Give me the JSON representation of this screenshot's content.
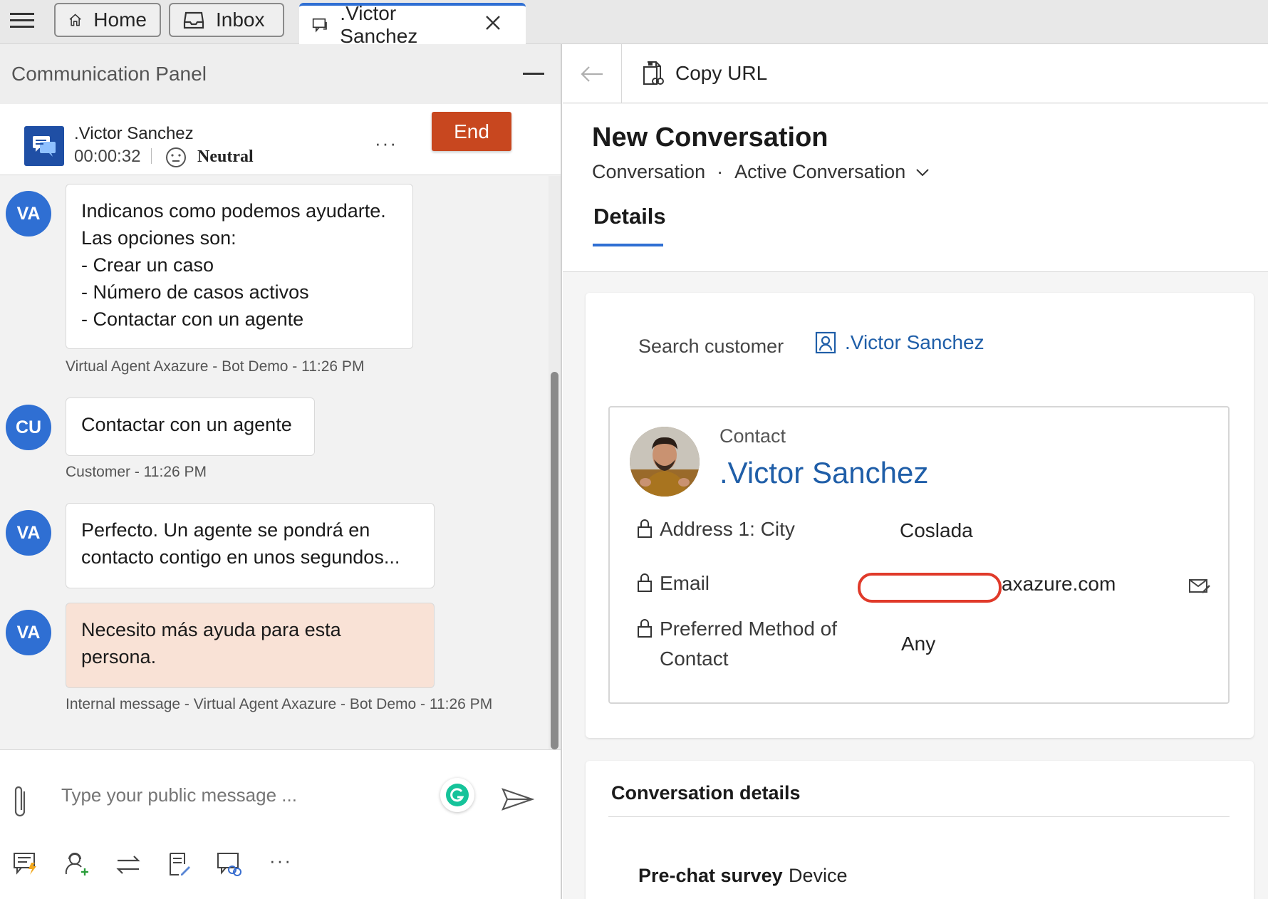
{
  "tabs": [
    {
      "label": "Home",
      "icon": "home-icon"
    },
    {
      "label": "Inbox",
      "icon": "inbox-icon"
    },
    {
      "label": ".Victor Sanchez",
      "icon": "conversation-icon"
    }
  ],
  "comm_panel": {
    "title": "Communication Panel",
    "session": {
      "name": ".Victor Sanchez",
      "timer": "00:00:32",
      "sentiment": "Neutral",
      "end_label": "End"
    },
    "messages": [
      {
        "avatar": "VA",
        "lines": [
          "Indicanos como podemos ayudarte.",
          "Las opciones son:",
          "- Crear un caso",
          "- Número de casos activos",
          "- Contactar con un agente"
        ],
        "meta": "Virtual Agent Axazure - Bot Demo - 11:26 PM"
      },
      {
        "avatar": "CU",
        "lines": [
          "Contactar con un agente"
        ],
        "meta": "Customer - 11:26 PM"
      },
      {
        "avatar": "VA",
        "lines": [
          "Perfecto. Un agente se pondrá en",
          "contacto contigo en unos segundos..."
        ],
        "meta": ""
      },
      {
        "avatar": "VA",
        "lines": [
          "Necesito más ayuda para esta",
          "persona."
        ],
        "meta": "Internal message - Virtual Agent Axazure - Bot Demo - 11:26 PM"
      }
    ],
    "composer_placeholder": "Type your public message ...",
    "toolbar_more": "···"
  },
  "right_panel": {
    "copy_url_label": "Copy URL",
    "form_title": "New Conversation",
    "entity": "Conversation",
    "separator": "·",
    "form_name": "Active Conversation",
    "tab_details": "Details",
    "search_customer_label": "Search customer",
    "customer_link": ".Victor Sanchez",
    "contact": {
      "type_label": "Contact",
      "name": ".Victor Sanchez",
      "fields": [
        {
          "label": "Address 1: City",
          "value": "Coslada"
        },
        {
          "label": "Email",
          "value": "axazure.com"
        },
        {
          "label_lines": [
            "Preferred Method of",
            "Contact"
          ],
          "value": "Any"
        }
      ]
    },
    "conversation_details": {
      "title": "Conversation details",
      "pre_chat_label": "Pre-chat survey",
      "device_label": "Device"
    }
  },
  "colors": {
    "accent": "#2f6fd3",
    "end_button": "#c8471f",
    "internal_bubble": "#f9e2d6",
    "link": "#1f5ea8",
    "redaction": "#e03a2a"
  }
}
